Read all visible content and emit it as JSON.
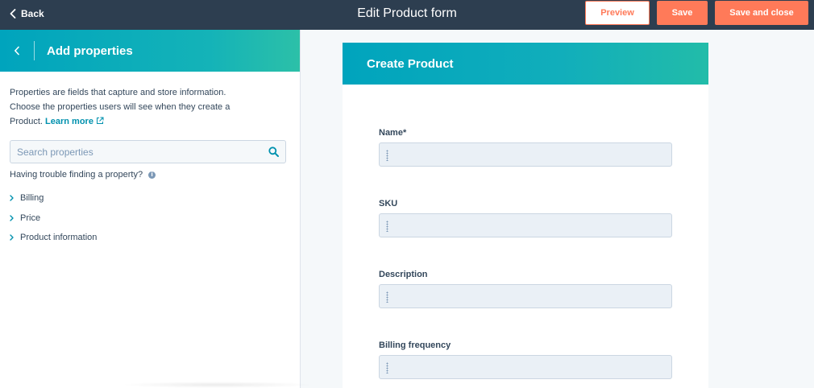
{
  "topbar": {
    "back_label": "Back",
    "title": "Edit Product form",
    "preview_label": "Preview",
    "save_label": "Save",
    "save_close_label": "Save and close"
  },
  "panel": {
    "title": "Add properties",
    "description": "Properties are fields that capture and store information. Choose the properties users will see when they create a Product.",
    "learn_more": "Learn more",
    "search_placeholder": "Search properties",
    "trouble_text": "Having trouble finding a property?",
    "info_glyph": "i",
    "groups": [
      {
        "label": "Billing"
      },
      {
        "label": "Price"
      },
      {
        "label": "Product information"
      }
    ]
  },
  "form": {
    "title": "Create Product",
    "fields": [
      {
        "label": "Name*",
        "value": ""
      },
      {
        "label": "SKU",
        "value": ""
      },
      {
        "label": "Description",
        "value": ""
      },
      {
        "label": "Billing frequency",
        "value": ""
      }
    ]
  },
  "colors": {
    "topbar": "#2d3e50",
    "accent": "#ff7a59",
    "teal": "#00a4bd",
    "link": "#0091ae"
  },
  "icons": [
    "chevron-left-icon",
    "search-icon",
    "external-link-icon",
    "info-icon",
    "chevron-right-icon",
    "drag-handle-icon"
  ]
}
